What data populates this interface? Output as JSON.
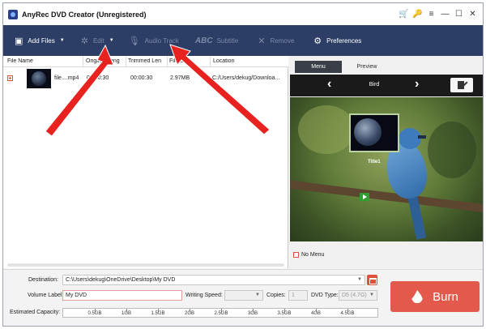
{
  "window": {
    "title": "AnyRec DVD Creator (Unregistered)",
    "controls": [
      "🛒",
      "🔑",
      "≡",
      "—",
      "☐",
      "✕"
    ]
  },
  "toolbar": {
    "add_files": "Add Files",
    "edit": "Edit",
    "audio_track": "Audio Track",
    "subtitle_abc": "ABC",
    "subtitle": "Subtitle",
    "remove": "Remove",
    "preferences": "Preferences"
  },
  "file_list": {
    "columns": [
      "File Name",
      "Original Leng",
      "Trimmed Len",
      "File Size",
      "Location"
    ],
    "rows": [
      {
        "file_name": "file....mp4",
        "original_length": "00:00:30",
        "trimmed_length": "00:00:30",
        "size": "2.97MB",
        "location": "C:/Users/dekug/Downloa..."
      }
    ]
  },
  "preview": {
    "tabs": [
      "Menu",
      "Preview"
    ],
    "theme_name": "Bird",
    "menu_item_label": "Title1",
    "no_menu_label": "No Menu"
  },
  "bottom": {
    "destination_label": "Destination:",
    "destination_value": "C:\\Users\\dekug\\OneDrive\\Desktop\\My DVD",
    "volume_label": "Volume Label:",
    "volume_value": "My DVD",
    "writing_speed_label": "Writing Speed:",
    "copies_label": "Copies:",
    "copies_value": "1",
    "dvd_type_label": "DVD Type:",
    "dvd_type_value": "D5 (4.7G)",
    "capacity_label": "Estimated Capacity:",
    "capacity_ticks": [
      "0.5GB",
      "1GB",
      "1.5GB",
      "2GB",
      "2.5GB",
      "3GB",
      "3.5GB",
      "4GB",
      "4.5GB"
    ],
    "burn": "Burn"
  },
  "colors": {
    "toolbar_bg": "#2c3e66",
    "accent_red": "#e35a4d",
    "annotation_arrow": "#e8231f"
  },
  "icons": [
    "cart-icon",
    "key-icon",
    "menu-icon",
    "add-files-icon",
    "edit-icon",
    "microphone-icon",
    "remove-icon",
    "preferences-gear-icon",
    "folder-icon",
    "flame-icon"
  ]
}
